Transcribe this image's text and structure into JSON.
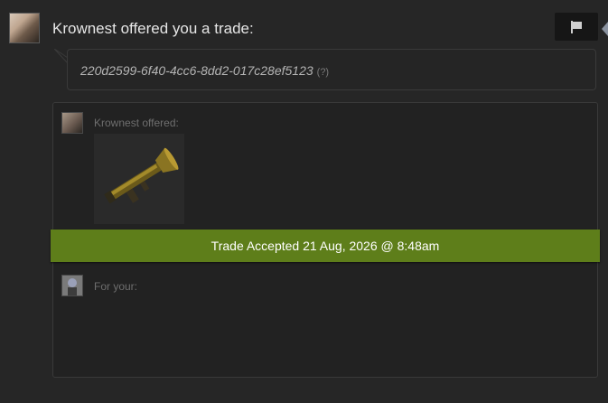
{
  "header": {
    "headline": "Krownest offered you a trade:",
    "report_icon": "flag-icon"
  },
  "message": {
    "trade_id": "220d2599-6f40-4cc6-8dd2-017c28ef5123",
    "help_marker": "(?)"
  },
  "offer": {
    "offered_label": "Krownest offered:",
    "item_icon": "rocket-launcher-item-icon",
    "for_label": "For your:"
  },
  "status": {
    "text": "Trade Accepted 21 Aug, 2026 @ 8:48am",
    "color": "#5e7e1a"
  }
}
